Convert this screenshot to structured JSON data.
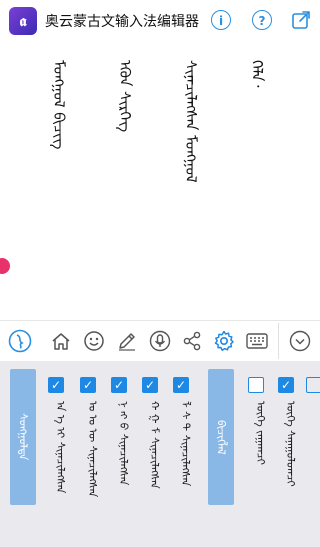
{
  "header": {
    "app_title": "奥云蒙古文输入法编辑器",
    "icons": [
      "info-icon",
      "help-icon",
      "share-icon"
    ]
  },
  "editor": {
    "text_lines": [
      "ᠮᠣᠩᠭᠣᠯ ᠪᠢᠴᠢᠭ",
      "ᠡᠭᠦᠨ ᠰᠢᠷᠬᠡᠭ",
      "ᠰᠢᠨᠡᠴᠢᠯᠡᠭᠰᠡᠨ ᠮᠣᠩᠭᠣᠯ",
      "ᠬᠡᠯᠡ᠂"
    ]
  },
  "toolbar": {
    "icons": [
      "app-logo-icon",
      "home-icon",
      "emoji-icon",
      "pen-icon",
      "microphone-icon",
      "share-nodes-icon",
      "gear-icon",
      "keyboard-icon",
      "chevron-down-icon"
    ]
  },
  "settings": {
    "group1_header": "ᠰᠣᠩᠭᠣᠯᠲᠠ",
    "group1_options": [
      {
        "label": "ᠠ ᠡ ᠢ ᠰᠢᠨᠡᠴᠢᠯᠡᠭᠰᠡᠨ",
        "checked": true
      },
      {
        "label": "ᠣ ᠤ ᠥ ᠰᠢᠨᠡᠴᠢᠯᠡᠭᠰᠡᠨ",
        "checked": true
      },
      {
        "label": "ᠨ ᠩ ᠪ ᠰᠢᠨᠡᠴᠢᠯᠡᠭᠰᠡᠨ",
        "checked": true
      },
      {
        "label": "ᠬ ᠭ ᠮ ᠰᠢᠨᠡᠴᠢᠯᠡᠭᠰᠡᠨ",
        "checked": true
      },
      {
        "label": "ᠯ ᠰ ᠲ ᠰᠢᠨᠡᠴᠢᠯᠡᠭᠰᠡᠨ",
        "checked": true
      }
    ],
    "group2_header": "ᠪᠢᠴᠢᠭᠯᠡᠯ",
    "group2_options": [
      {
        "label": "ᠦᠭᠡ ᠵᠠᠭᠠᠭᠴᠢ",
        "checked": false
      },
      {
        "label": "ᠦᠭᠡ ᠰᠠᠨᠠᠭᠤᠯᠤᠭᠴᠢ",
        "checked": true
      }
    ]
  }
}
